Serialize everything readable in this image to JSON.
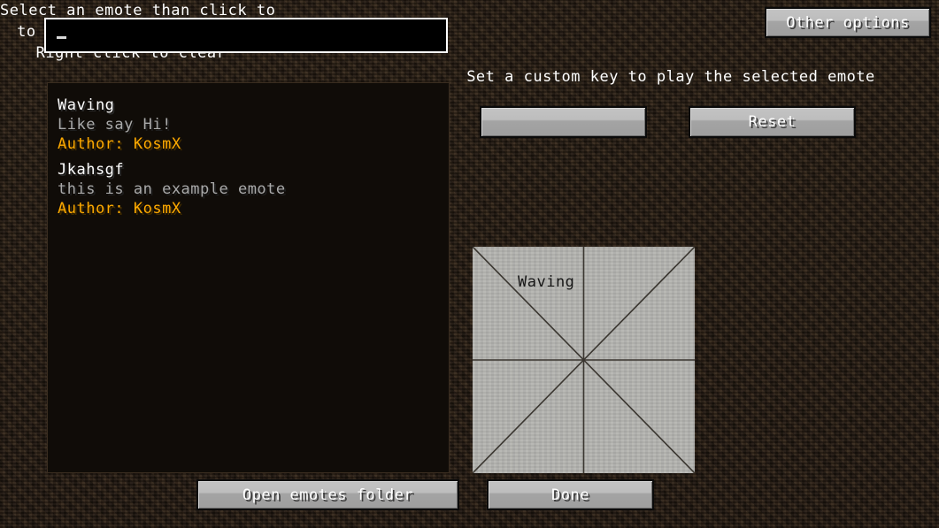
{
  "search": {
    "value": "",
    "placeholder": "",
    "caret": "_"
  },
  "emote_list": [
    {
      "title": "Waving",
      "description": "Like say Hi!",
      "author": "Author: KosmX"
    },
    {
      "title": "Jkahsgf",
      "description": "this is an example emote",
      "author": "Author: KosmX"
    }
  ],
  "buttons": {
    "other_options": "Other options",
    "keybind": "",
    "reset": "Reset",
    "open_emotes_folder": "Open emotes folder",
    "done": "Done"
  },
  "labels": {
    "keybind_header": "Set a custom key to play the selected emote",
    "wheel_instructions_line1": "Select an emote than click to",
    "wheel_instructions_line2": "to add to the fast menu.",
    "wheel_instructions_line3": "Right click to clear"
  },
  "fast_menu": {
    "slot_count": 8,
    "slots": [
      {
        "position": "top-left",
        "label": "Waving"
      },
      {
        "position": "top-right",
        "label": ""
      },
      {
        "position": "right-top",
        "label": ""
      },
      {
        "position": "right-bottom",
        "label": ""
      },
      {
        "position": "bottom-right",
        "label": ""
      },
      {
        "position": "bottom-left",
        "label": ""
      },
      {
        "position": "left-bottom",
        "label": ""
      },
      {
        "position": "left-top",
        "label": ""
      }
    ],
    "assigned_label": "Waving"
  },
  "colors": {
    "background_dirt": "#2b2016",
    "panel_background": "#100c08",
    "author_gold": "#ffaa00",
    "description_gray": "#a9a9a9",
    "title_white": "#ffffff",
    "button_gray": "#bdbdbd",
    "wheel_gray": "#b2b2ae"
  }
}
